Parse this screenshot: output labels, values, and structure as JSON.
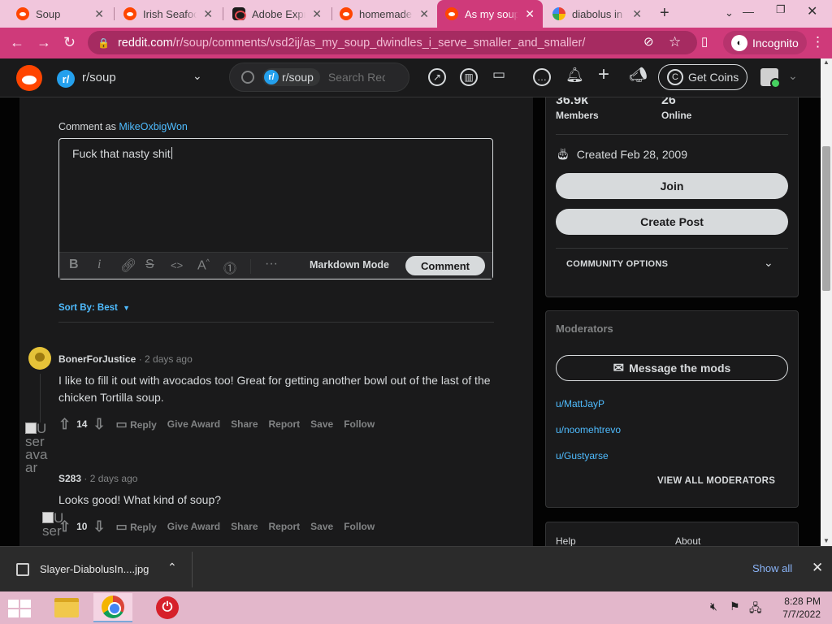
{
  "browser": {
    "tabs": [
      {
        "title": "Soup",
        "icon": "reddit-favicon",
        "active": false
      },
      {
        "title": "Irish Seafood",
        "icon": "reddit-favicon",
        "active": false
      },
      {
        "title": "Adobe Express",
        "icon": "adobe-express-favicon",
        "active": false
      },
      {
        "title": "homemade",
        "icon": "reddit-favicon",
        "active": false
      },
      {
        "title": "As my soup",
        "icon": "reddit-favicon",
        "active": true
      },
      {
        "title": "diabolus in",
        "icon": "google-favicon",
        "active": false
      }
    ],
    "url_host": "reddit.com",
    "url_path": "/r/soup/comments/vsd2ij/as_my_soup_dwindles_i_serve_smaller_and_smaller/",
    "incognito_label": "Incognito",
    "tab_color": "#cf3a7a"
  },
  "header": {
    "subreddit": "r/soup",
    "search_chip": "r/soup",
    "search_placeholder": "Search Reddit",
    "coins_label": "Get Coins",
    "brand_color": "#ff4500"
  },
  "compose": {
    "comment_as_label": "Comment as",
    "username": "MikeOxbigWon",
    "draft": "Fuck that nasty shit",
    "markdown_label": "Markdown Mode",
    "submit_label": "Comment",
    "more_label": "···"
  },
  "sort": {
    "label": "Sort By: Best"
  },
  "comments": [
    {
      "author": "BonerForJustice",
      "time": "· 2 days ago",
      "body": "I like to fill it out with avocados too! Great for getting another bowl out of the last of the chicken Tortilla soup.",
      "score": "14"
    },
    {
      "author": "S283",
      "time": "· 2 days ago",
      "body": "Looks good! What kind of soup?",
      "score": "10"
    }
  ],
  "comment_actions": {
    "reply": "Reply",
    "award": "Give Award",
    "share": "Share",
    "report": "Report",
    "save": "Save",
    "follow": "Follow"
  },
  "broken_image_alt": {
    "line1": "U",
    "line2": "ser",
    "line3": "ava",
    "line4": "ar"
  },
  "broken_image_alt2": {
    "line1": "U",
    "line2": "ser"
  },
  "sidebar": {
    "members_count": "36.9k",
    "members_label": "Members",
    "online_count": "26",
    "online_label": "Online",
    "created": "Created Feb 28, 2009",
    "join_label": "Join",
    "create_post_label": "Create Post",
    "community_options_label": "COMMUNITY OPTIONS",
    "moderators_title": "Moderators",
    "message_mods_label": "Message the mods",
    "moderators": [
      "u/MattJayP",
      "u/noomehtrevo",
      "u/Gustyarse"
    ],
    "view_all_label": "VIEW ALL MODERATORS",
    "footer_links": [
      "Help",
      "About"
    ]
  },
  "downloads": {
    "filename": "Slayer-DiabolusIn....jpg",
    "show_all_label": "Show all"
  },
  "taskbar": {
    "time": "8:28 PM",
    "date": "7/7/2022"
  }
}
